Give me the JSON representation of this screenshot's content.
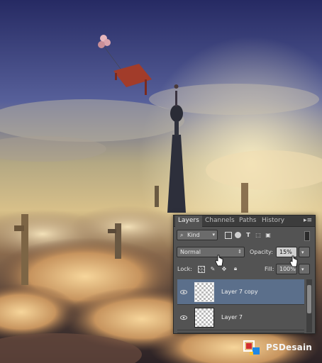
{
  "panel": {
    "tabs": [
      {
        "label": "Layers",
        "active": true
      },
      {
        "label": "Channels",
        "active": false
      },
      {
        "label": "Paths",
        "active": false
      },
      {
        "label": "History",
        "active": false
      }
    ],
    "filter": {
      "label": "Kind"
    },
    "blend_mode": "Normal",
    "opacity": {
      "label": "Opacity:",
      "value": "15%"
    },
    "lock": {
      "label": "Lock:"
    },
    "fill": {
      "label": "Fill:",
      "value": "100%"
    },
    "layers": [
      {
        "name": "Layer 7 copy",
        "selected": true
      },
      {
        "name": "Layer 7",
        "selected": false
      }
    ]
  },
  "watermark": {
    "text": "PSDesain"
  },
  "colors": {
    "panel_bg": "#535353",
    "tab_bar": "#3c3c3c",
    "selected_layer": "#5b6f8b",
    "logo_red": "#d32f2f",
    "logo_blue": "#1e88e5",
    "logo_yellow": "#fbc02d"
  }
}
